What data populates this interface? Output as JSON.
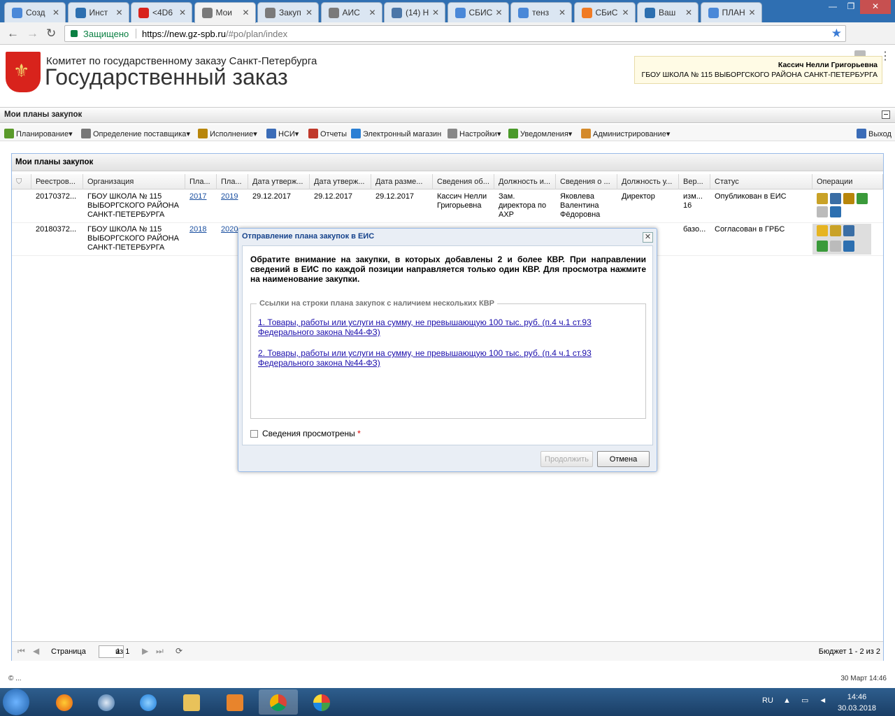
{
  "browser": {
    "tabs": [
      {
        "label": "Созд",
        "icon": "google-icon",
        "color": "#4a88d8"
      },
      {
        "label": "Инст",
        "icon": "info-icon",
        "color": "#2c6fb0"
      },
      {
        "label": "<4D6",
        "icon": "spb-gz-icon",
        "color": "#d8231c"
      },
      {
        "label": "Мои",
        "icon": "gavel-icon",
        "color": "#7a7a7a"
      },
      {
        "label": "Закуп",
        "icon": "gavel-icon",
        "color": "#7a7a7a"
      },
      {
        "label": "АИС",
        "icon": "gavel-icon",
        "color": "#7a7a7a"
      },
      {
        "label": "(14) Н",
        "icon": "vk-icon",
        "color": "#4a76a8"
      },
      {
        "label": "СБИС",
        "icon": "google-icon",
        "color": "#4a88d8"
      },
      {
        "label": "тенз",
        "icon": "google-icon",
        "color": "#4a88d8"
      },
      {
        "label": "СБиС",
        "icon": "sbis-icon",
        "color": "#f07b24"
      },
      {
        "label": "Ваш",
        "icon": "info-icon",
        "color": "#2c6fb0"
      },
      {
        "label": "ПЛАН",
        "icon": "google-icon",
        "color": "#4a88d8"
      }
    ],
    "secure_label": "Защищено",
    "url_main": "https://new.gz-spb.ru",
    "url_rest": "/#po/plan/index"
  },
  "header": {
    "org_title": "Комитет по государственному заказу Санкт-Петербурга",
    "site_title": "Государственный заказ",
    "user_name": "Кассич Нелли Григорьевна",
    "user_org": "ГБОУ ШКОЛА № 115 ВЫБОРГСКОГО РАЙОНА САНКТ-ПЕТЕРБУРГА"
  },
  "section_title": "Мои планы закупок",
  "menu": {
    "items": [
      {
        "label": "Планирование",
        "arrow": "▾",
        "color": "#5a9a2a"
      },
      {
        "label": "Определение поставщика",
        "arrow": "▾",
        "color": "#777"
      },
      {
        "label": "Исполнение",
        "arrow": "▾",
        "color": "#b8860b"
      },
      {
        "label": "НСИ",
        "arrow": "▾",
        "color": "#3b6cb7"
      },
      {
        "label": "Отчеты",
        "arrow": "",
        "color": "#c0392b"
      },
      {
        "label": "Электронный магазин",
        "arrow": "",
        "color": "#2a7fd4"
      },
      {
        "label": "Настройки",
        "arrow": "▾",
        "color": "#888"
      },
      {
        "label": "Уведомления",
        "arrow": "▾",
        "color": "#4a9a2a"
      },
      {
        "label": "Администрирование",
        "arrow": "▾",
        "color": "#d48a2a"
      }
    ],
    "logout": "Выход"
  },
  "panel": {
    "title": "Мои планы закупок",
    "columns": [
      "Реестров...",
      "Организация",
      "Пла...",
      "Пла...",
      "Дата утверж...",
      "Дата утверж...",
      "Дата разме...",
      "Сведения об...",
      "Должность и...",
      "Сведения о ...",
      "Должность у...",
      "Вер...",
      "Статус",
      "Операции"
    ],
    "rows": [
      {
        "reg": "20170372...",
        "org": "ГБОУ ШКОЛА № 115 ВЫБОРГСКОГО РАЙОНА САНКТ-ПЕТЕРБУРГА",
        "plan_from": "2017",
        "plan_to": "2019",
        "date1": "29.12.2017",
        "date2": "29.12.2017",
        "date3": "29.12.2017",
        "info": "Кассич Нелли Григорьевна",
        "position": "Зам. директора по АХР",
        "info2": "Яковлева Валентина Фёдоровна",
        "position2": "Директор",
        "version": "изм... 16",
        "status": "Опубликован в ЕИС"
      },
      {
        "reg": "20180372...",
        "org": "ГБОУ ШКОЛА № 115 ВЫБОРГСКОГО РАЙОНА САНКТ-ПЕТЕРБУРГА",
        "plan_from": "2018",
        "plan_to": "2020",
        "version": "базо...",
        "status": "Согласован в ГРБС"
      }
    ]
  },
  "paging": {
    "page_label": "Страница",
    "page_value": "1",
    "of_label": "из 1",
    "summary": "Бюджет 1 - 2 из 2"
  },
  "footer": {
    "left": "© ...",
    "right": "30 Март 14:46"
  },
  "dialog": {
    "title": "Отправление плана закупок в ЕИС",
    "message": "Обратите внимание на закупки, в которых добавлены 2 и более КВР. При направлении сведений в ЕИС по каждой позиции направляется только один КВР. Для просмотра нажмите на наименование закупки.",
    "legend": "Ссылки на строки плана закупок с наличием нескольких КВР",
    "links": [
      "1. Товары, работы или услуги на сумму, не превышающую 100 тыс. руб. (п.4 ч.1 ст.93 Федерального закона №44-ФЗ)",
      "2. Товары, работы или услуги на сумму, не превышающую 100 тыс. руб. (п.4 ч.1 ст.93 Федерального закона №44-ФЗ)"
    ],
    "checkbox_label": "Сведения просмотрены",
    "required_mark": "*",
    "continue_label": "Продолжить",
    "cancel_label": "Отмена"
  },
  "taskbar": {
    "lang": "RU",
    "time": "14:46",
    "date": "30.03.2018"
  }
}
